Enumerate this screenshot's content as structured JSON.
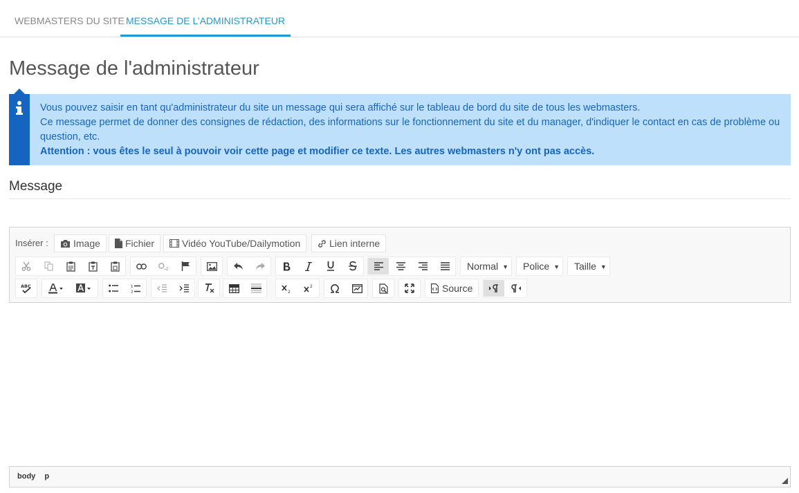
{
  "tabs": [
    {
      "label": "WEBMASTERS DU SITE",
      "active": false
    },
    {
      "label": "MESSAGE DE L’ADMINISTRATEUR",
      "active": true
    }
  ],
  "page_title": "Message de l'administrateur",
  "info": {
    "line1": "Vous pouvez saisir en tant qu'administrateur du site un message qui sera affiché sur le tableau de bord du site de tous les webmasters.",
    "line2": "Ce message permet de donner des consignes de rédaction, des informations sur le fonctionnement du site et du manager, d'indiquer le contact en cas de problème ou question, etc.",
    "line3": "Attention : vous êtes le seul à pouvoir voir cette page et modifier ce texte. Les autres webmasters n'y ont pas accès."
  },
  "section_title": "Message",
  "editor": {
    "insert_label": "Insérer :",
    "insert_buttons": {
      "image": "Image",
      "file": "Fichier",
      "video": "Vidéo YouTube/Dailymotion",
      "link": "Lien interne"
    },
    "format_combo": "Normal",
    "font_combo": "Police",
    "size_combo": "Taille",
    "source_label": "Source",
    "path": [
      "body",
      "p"
    ]
  },
  "colors": {
    "accent": "#1e9ad6",
    "info_bg": "#bfe0fb",
    "info_text": "#1565c0"
  }
}
